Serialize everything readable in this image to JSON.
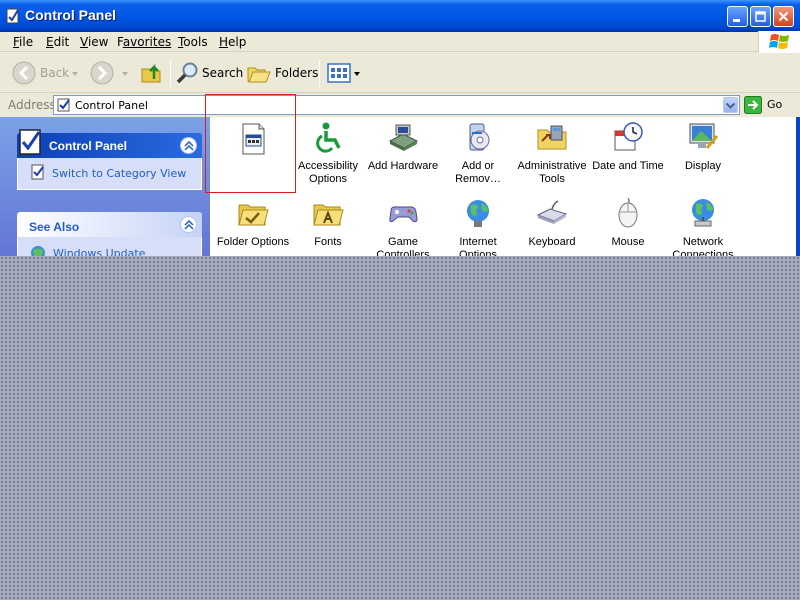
{
  "window": {
    "title": "Control Panel",
    "accent": "#0058e6"
  },
  "menu": [
    {
      "ul": "F",
      "rest": "ile"
    },
    {
      "ul": "E",
      "rest": "dit"
    },
    {
      "ul": "V",
      "rest": "iew"
    },
    {
      "ul": "",
      "rest": "Favorites",
      "pre": "F",
      "after": "avorites"
    },
    {
      "ul": "T",
      "rest": "ools"
    },
    {
      "ul": "H",
      "rest": "elp"
    }
  ],
  "toolbar": {
    "back_label": "Back",
    "search_label": "Search",
    "folders_label": "Folders"
  },
  "address": {
    "label": "Address",
    "value": "Control Panel",
    "go_label": "Go"
  },
  "leftpane": {
    "control_panel_title": "Control Panel",
    "switch_view_link": "Switch to Category View",
    "see_also_title": "See Also",
    "windows_update_link": "Windows Update"
  },
  "items": [
    {
      "label": "",
      "icon": "unknown-applet-icon"
    },
    {
      "label": "Accessibility Options",
      "icon": "accessibility-icon"
    },
    {
      "label": "Add Hardware",
      "icon": "add-hardware-icon"
    },
    {
      "label": "Add or Remov…",
      "icon": "add-remove-programs-icon"
    },
    {
      "label": "Administrative Tools",
      "icon": "administrative-tools-icon"
    },
    {
      "label": "Date and Time",
      "icon": "date-time-icon"
    },
    {
      "label": "Display",
      "icon": "display-icon"
    },
    {
      "label": "Folder Options",
      "icon": "folder-options-icon"
    },
    {
      "label": "Fonts",
      "icon": "fonts-icon"
    },
    {
      "label": "Game Controllers",
      "icon": "game-controllers-icon"
    },
    {
      "label": "Internet Options",
      "icon": "internet-options-icon"
    },
    {
      "label": "Keyboard",
      "icon": "keyboard-icon"
    },
    {
      "label": "Mouse",
      "icon": "mouse-icon"
    },
    {
      "label": "Network Connections",
      "icon": "network-connections-icon"
    }
  ]
}
